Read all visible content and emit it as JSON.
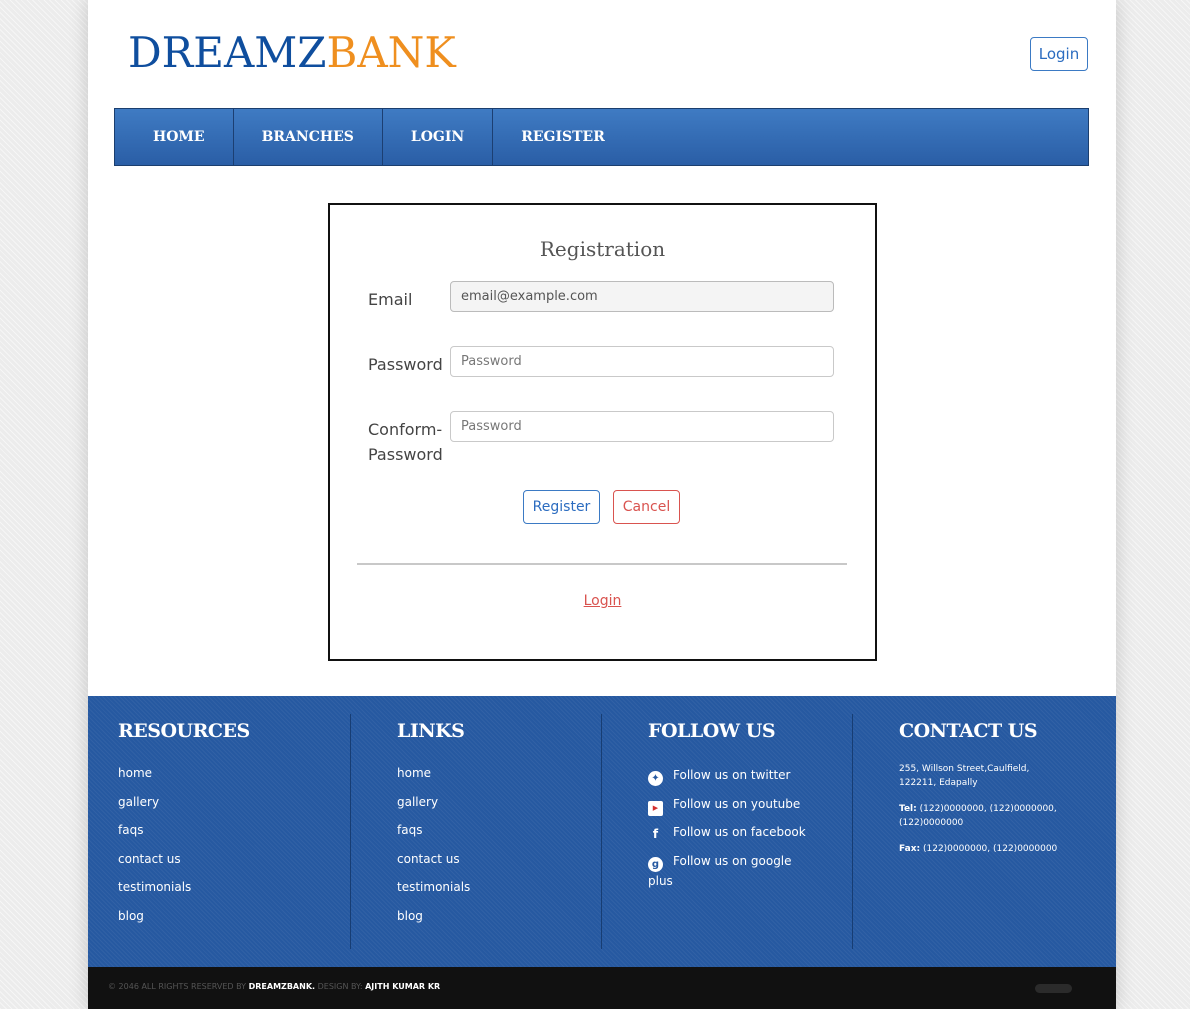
{
  "brand": {
    "part1": "DREAMZ",
    "part2": "BANK",
    "color1": "#0f4e9e",
    "color2": "#ef8f1f"
  },
  "header": {
    "login_label": "Login"
  },
  "nav": {
    "items": [
      "HOME",
      "BRANCHES",
      "LOGIN",
      "REGISTER"
    ]
  },
  "form": {
    "title": "Registration",
    "email_label": "Email",
    "email_value": "email@example.com",
    "password_label": "Password",
    "password_placeholder": "Password",
    "confirm_label_line1": "Conform-",
    "confirm_label_line2": "Password",
    "confirm_placeholder": "Password",
    "register_label": "Register",
    "cancel_label": "Cancel",
    "login_link": "Login"
  },
  "footer": {
    "resources": {
      "title": "RESOURCES",
      "links": [
        "home",
        "gallery",
        "faqs",
        "contact us",
        "testimonials",
        "blog"
      ]
    },
    "links": {
      "title": "LINKS",
      "links": [
        "home",
        "gallery",
        "faqs",
        "contact us",
        "testimonials",
        "blog"
      ]
    },
    "follow": {
      "title": "FOLLOW US",
      "items": [
        {
          "icon": "twitter-icon",
          "label": "Follow us on twitter"
        },
        {
          "icon": "youtube-icon",
          "label": "Follow us on youtube"
        },
        {
          "icon": "facebook-icon",
          "label": "Follow us on facebook"
        },
        {
          "icon": "google-plus-icon",
          "label": "Follow us on google",
          "label2": "plus"
        }
      ]
    },
    "contact": {
      "title": "CONTACT US",
      "address": "255, Willson Street,Caulfield, 122211, Edapally",
      "tel_label": "Tel:",
      "tel": "(122)0000000, (122)0000000, (122)0000000",
      "fax_label": "Fax:",
      "fax": "(122)0000000, (122)0000000"
    }
  },
  "bottom": {
    "copy_prefix": "© 2046 ALL RIGHTS RESERVED BY",
    "brand": "DREAMZBANK.",
    "design_prefix": "DESIGN BY:",
    "designer": "AJITH KUMAR KR"
  },
  "colors": {
    "nav_blue": "#2f68b0",
    "footer_blue": "#2659a1",
    "accent_red": "#d9534f"
  }
}
